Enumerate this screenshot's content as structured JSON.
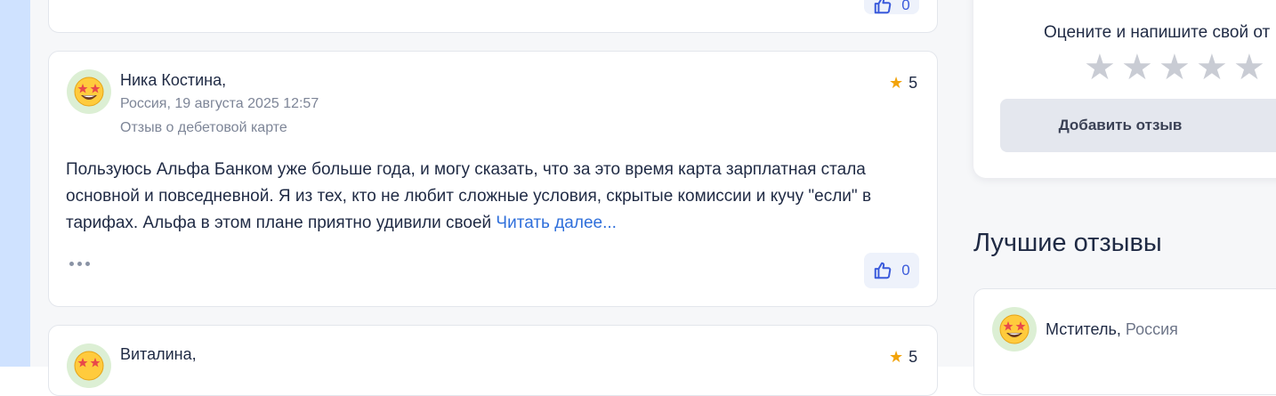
{
  "reviews": [
    {
      "likes": "0"
    },
    {
      "author": "Ника Костина,",
      "location_date": "Россия, 19 августа 2025 12:57",
      "category": "Отзыв о дебетовой карте",
      "rating": "5",
      "text": "Пользуюсь Альфа Банком уже больше года, и могу сказать, что за это время карта зарплатная стала основной и повседневной. Я из тех, кто не любит сложные условия, скрытые комиссии и кучу \"если\" в тарифах. Альфа в этом плане приятно удивили своей ",
      "read_more": "Читать далее...",
      "likes": "0"
    },
    {
      "author": "Виталина,",
      "rating": "5"
    }
  ],
  "sidebar": {
    "rate_prompt": "Оцените и напишите свой от",
    "stars": [
      "★",
      "★",
      "★",
      "★",
      "★"
    ],
    "add_review": "Добавить отзыв",
    "best_reviews_title": "Лучшие отзывы",
    "best_review": {
      "author": "Мститель",
      "separator": ", ",
      "location": "Россия"
    }
  },
  "colors": {
    "accent": "#2f6fdb",
    "star_active": "#f2a30a",
    "star_inactive": "#c9ccd4",
    "left_strip": "#cfe2ff"
  },
  "icons": {
    "avatar": "star-struck-emoji-icon",
    "like": "thumbs-up-icon",
    "more": "more-dots-icon",
    "rating": "star-icon"
  }
}
